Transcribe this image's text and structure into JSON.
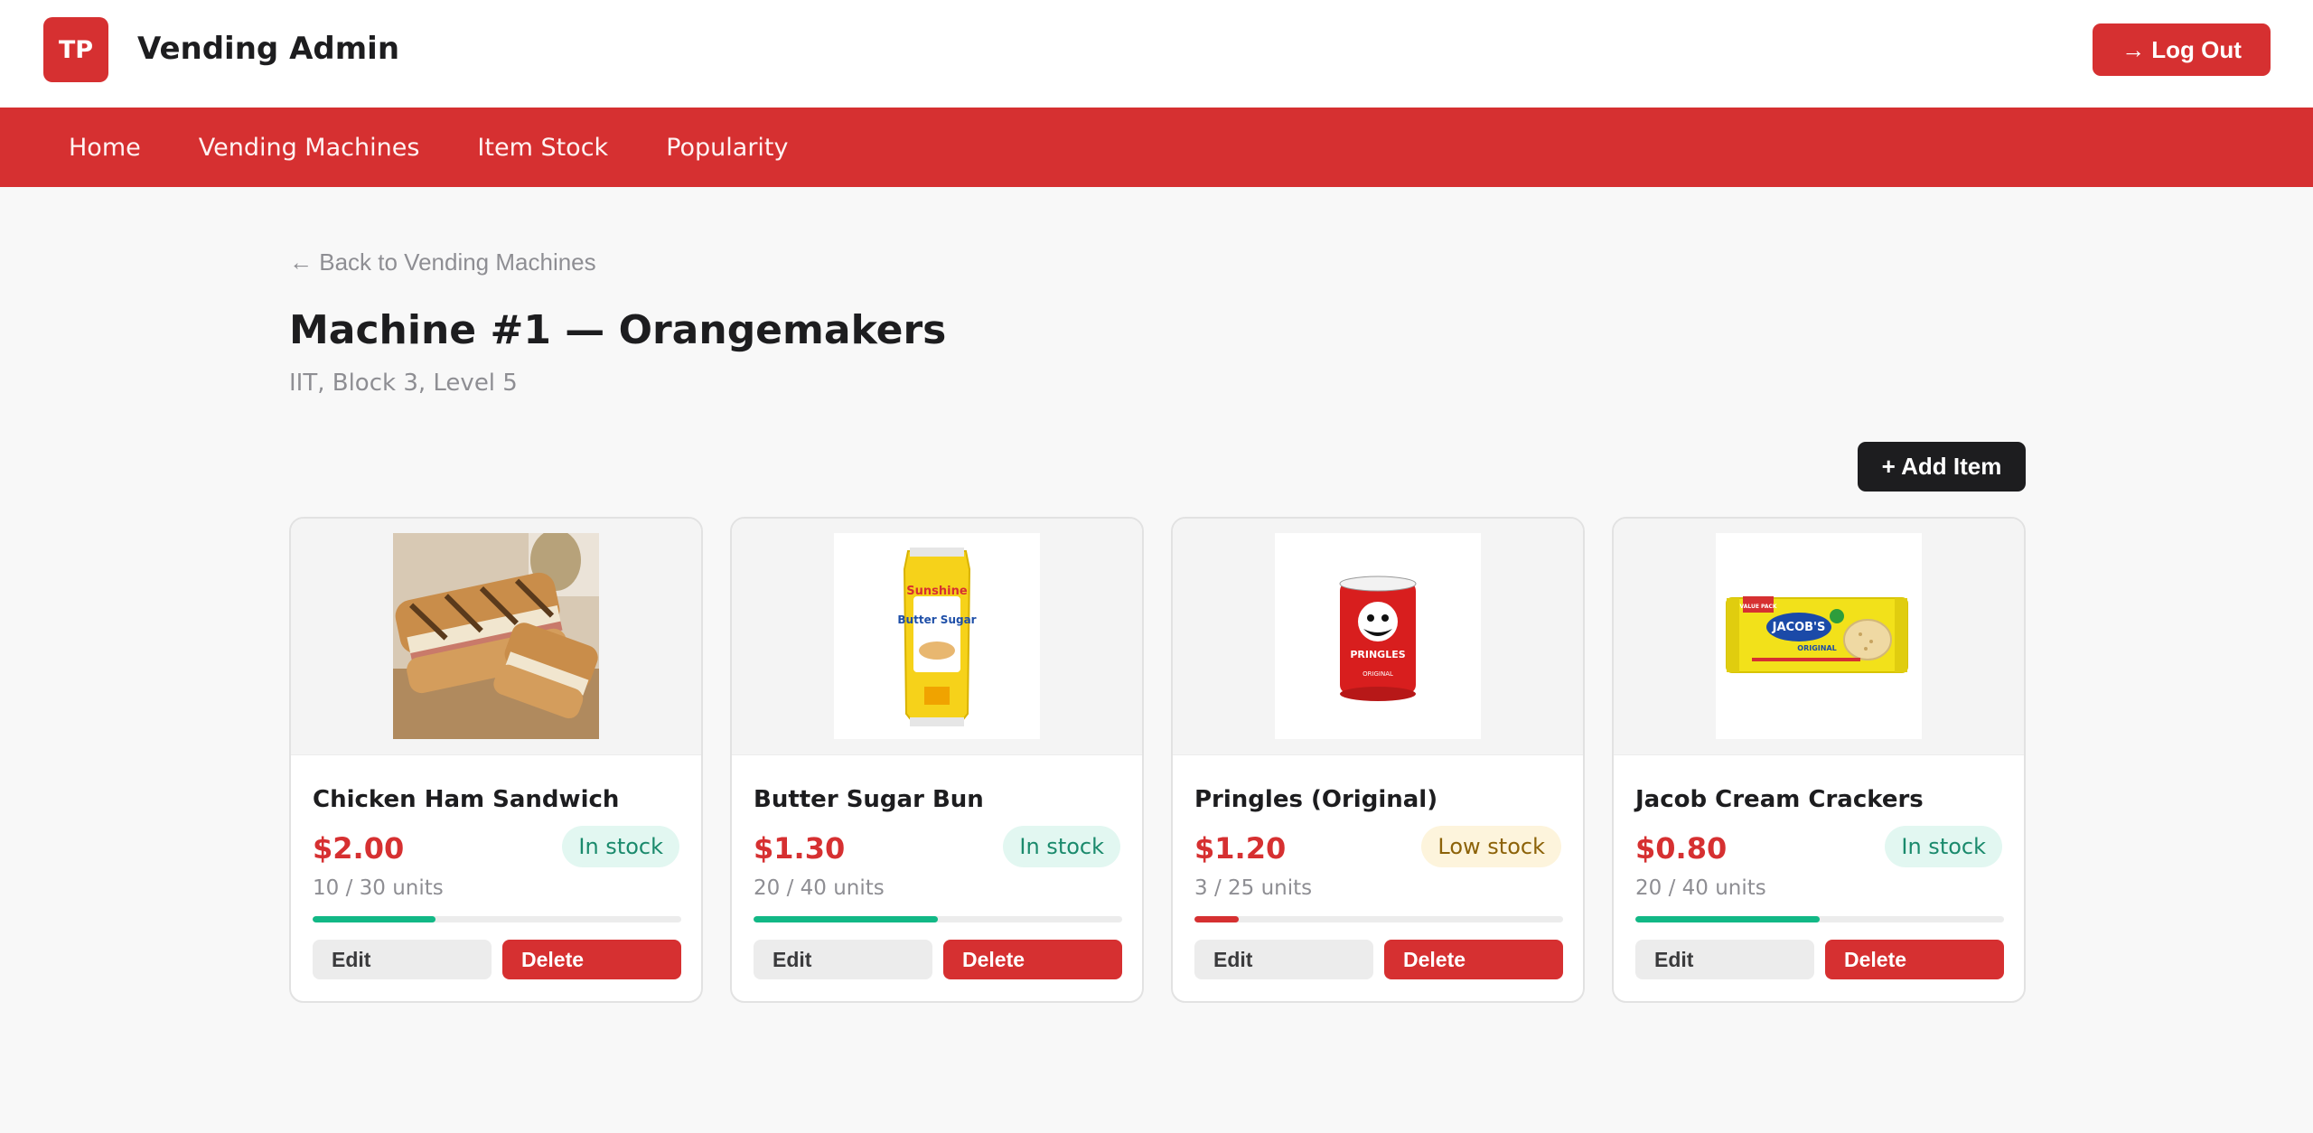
{
  "header": {
    "logo_text": "TP",
    "app_title": "Vending Admin",
    "logout_label": "→ Log Out"
  },
  "nav": {
    "items": [
      "Home",
      "Vending Machines",
      "Item Stock",
      "Popularity"
    ]
  },
  "main": {
    "back_link": "← Back to Vending Machines",
    "title": "Machine #1 — Orangemakers",
    "subtitle": "IIT, Block 3, Level 5",
    "add_item_label": "+ Add Item"
  },
  "items": [
    {
      "name": "Chicken Ham Sandwich",
      "price": "$2.00",
      "status": "In stock",
      "units": "10 / 30 units",
      "stock_fraction": 0.333,
      "bar_color": "#12b886",
      "edit_label": "Edit",
      "delete_label": "Delete",
      "image": "sandwich"
    },
    {
      "name": "Butter Sugar Bun",
      "price": "$1.30",
      "status": "In stock",
      "units": "20 / 40 units",
      "stock_fraction": 0.5,
      "bar_color": "#12b886",
      "edit_label": "Edit",
      "delete_label": "Delete",
      "image": "bun-pack"
    },
    {
      "name": "Pringles (Original)",
      "price": "$1.20",
      "status": "Low stock",
      "units": "3 / 25 units",
      "stock_fraction": 0.12,
      "bar_color": "#d63031",
      "edit_label": "Edit",
      "delete_label": "Delete",
      "image": "pringles-can"
    },
    {
      "name": "Jacob Cream Crackers",
      "price": "$0.80",
      "status": "In stock",
      "units": "20 / 40 units",
      "stock_fraction": 0.5,
      "bar_color": "#12b886",
      "edit_label": "Edit",
      "delete_label": "Delete",
      "image": "cracker-pack"
    }
  ],
  "image_text": {
    "bun_brand": "Sunshine",
    "bun_product": "Butter Sugar",
    "pringles_brand": "PRINGLES",
    "pringles_flavor": "ORIGINAL",
    "jacobs_brand": "JACOB'S",
    "jacobs_flavor": "ORIGINAL",
    "jacobs_tag": "VALUE PACK"
  },
  "colors": {
    "brand_red": "#d63031",
    "dark": "#1d1d1f",
    "in_stock_bg": "#e2f7f1",
    "in_stock_text": "#1a8a6c",
    "low_stock_bg": "#fdf4dc",
    "low_stock_text": "#8c6208",
    "bar_green": "#12b886"
  }
}
